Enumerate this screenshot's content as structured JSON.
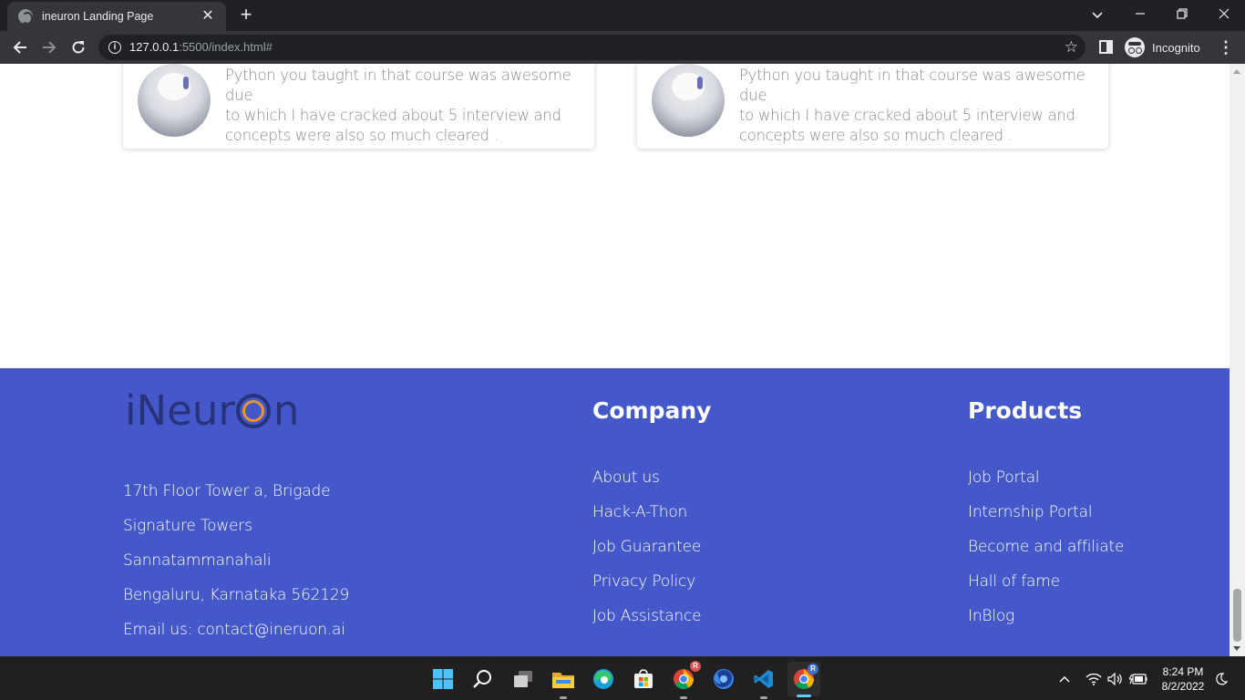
{
  "browser": {
    "tab_title": "ineuron Landing Page",
    "url_host": "127.0.0.1",
    "url_rest": ":5500/index.html#",
    "profile_label": "Incognito"
  },
  "testimonials": [
    {
      "lines": [
        "Python you taught in that course was awesome due",
        "to which I have cracked about 5 interview and",
        "concepts were also so much cleared ."
      ]
    },
    {
      "lines": [
        "Python you taught in that course was awesome due",
        "to which I have cracked about 5 interview and",
        "concepts were also so much cleared ."
      ]
    }
  ],
  "footer": {
    "logo": {
      "prefix": "iNeur",
      "suffix": "n"
    },
    "address": [
      "17th Floor Tower a, Brigade",
      "Signature Towers",
      "Sannatammanahali",
      "Bengaluru, Karnataka 562129",
      "Email us: contact@ineruon.ai"
    ],
    "company": {
      "heading": "Company",
      "links": [
        "About us",
        "Hack-A-Thon",
        "Job Guarantee",
        "Privacy Policy",
        "Job Assistance"
      ]
    },
    "products": {
      "heading": "Products",
      "links": [
        "Job Portal",
        "Internship Portal",
        "Become and affiliate",
        "Hall of fame",
        "InBlog"
      ]
    }
  },
  "taskbar": {
    "time": "8:24 PM",
    "date": "8/2/2022",
    "badge_chrome1": "R",
    "badge_chrome2": "R"
  },
  "colors": {
    "footer_bg": "#4558c9",
    "logo_dark": "#27327a",
    "logo_accent": "#f39323"
  }
}
